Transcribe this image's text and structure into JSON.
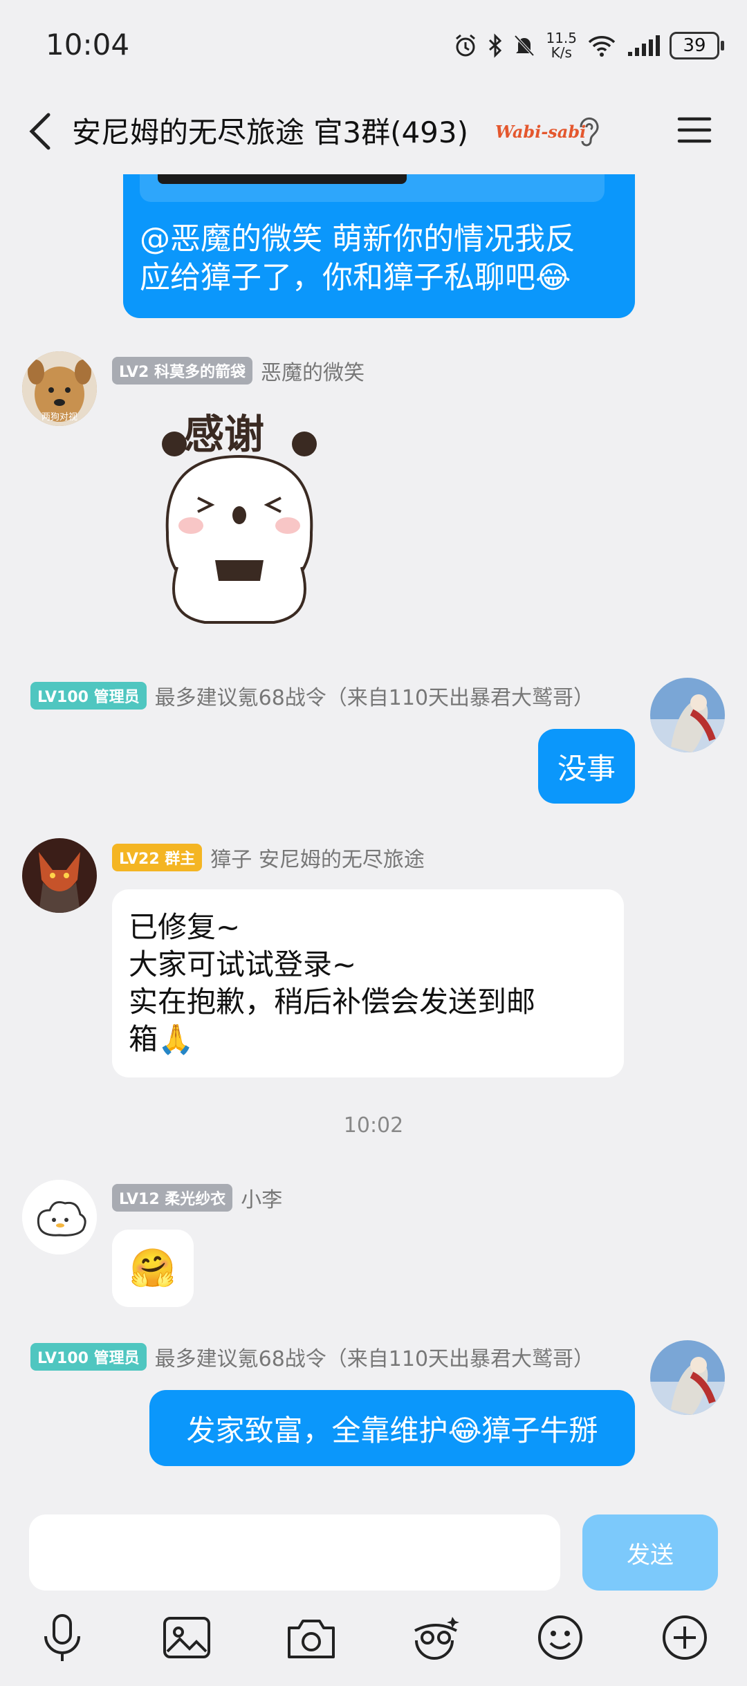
{
  "status": {
    "time": "10:04",
    "net_speed_value": "11.5",
    "net_speed_unit": "K/s",
    "battery": "39"
  },
  "header": {
    "title": "安尼姆的无尽旅途 官3群(493)",
    "tag": "Wabi-sabi"
  },
  "messages": [
    {
      "text_line1": "@恶魔的微笑 萌新你的情况我反",
      "text_line2": "应给獐子了，你和獐子私聊吧😂"
    },
    {
      "level": "LV2 科莫多的箭袋",
      "name": "恶魔的微笑",
      "sticker_text": "感谢",
      "avatar_caption": "两狗对视"
    },
    {
      "level": "LV100 管理员",
      "name": "最多建议氪68战令（来自110天出暴君大鹫哥）",
      "text": "没事"
    },
    {
      "level": "LV22 群主",
      "name": "獐子 安尼姆的无尽旅途",
      "lines": [
        "已修复~",
        "大家可试试登录~",
        "实在抱歉，稍后补偿会发送到邮",
        "箱🙏"
      ]
    },
    {
      "timestamp": "10:02"
    },
    {
      "level": "LV12 柔光纱衣",
      "name": "小李",
      "text": "🤗"
    },
    {
      "level": "LV100 管理员",
      "name": "最多建议氪68战令（来自110天出暴君大鹫哥）",
      "text": "发家致富，全靠维护😂獐子牛掰"
    }
  ],
  "composer": {
    "send_label": "发送"
  },
  "colors": {
    "bubble_blue": "#0b97fb",
    "background": "#f0f0f2",
    "send_disabled": "#7cc9fb"
  }
}
